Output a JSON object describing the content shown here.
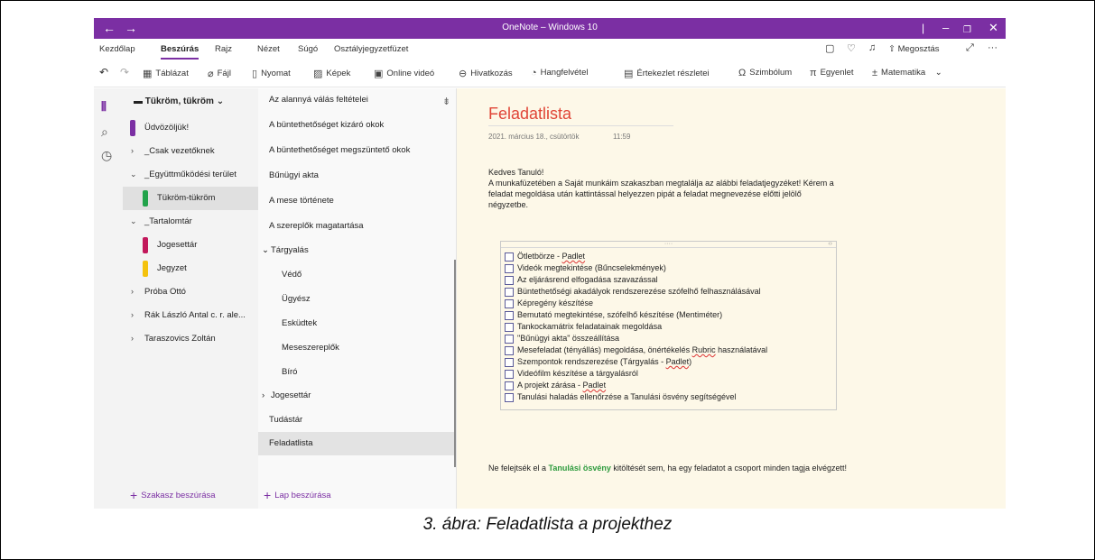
{
  "window": {
    "title": "OneNote – Windows 10",
    "back_icon": "arrow-left",
    "forward_icon": "arrow-right",
    "accent": "#7b2fa3"
  },
  "menu": {
    "items": [
      "Kezdőlap",
      "Beszúrás",
      "Rajz",
      "Nézet",
      "Súgó",
      "Osztályjegyzetfüzet"
    ],
    "active": "Beszúrás",
    "share": "Megosztás"
  },
  "toolbar": {
    "items": [
      "Táblázat",
      "Fájl",
      "Nyomat",
      "Képek",
      "Online videó",
      "Hivatkozás",
      "Hangfelvétel",
      "Értekezlet részletei",
      "Szimbólum",
      "Egyenlet",
      "Matematika"
    ]
  },
  "notebook": {
    "name": "Tükröm, tükröm"
  },
  "sections": [
    {
      "label": "Üdvözöljük!",
      "color": "#7b2fa3",
      "chevron": ""
    },
    {
      "label": "_Csak vezetőknek",
      "chevron": ">"
    },
    {
      "label": "_Együttműködési terület",
      "chevron": "v"
    },
    {
      "label": "Tükröm-tükröm",
      "color": "#22a34b",
      "chevron": ""
    },
    {
      "label": "_Tartalomtár",
      "chevron": "v"
    },
    {
      "label": "Jogesettár",
      "color": "#c2185b",
      "chevron": ""
    },
    {
      "label": "Jegyzet",
      "color": "#f4c20d",
      "chevron": ""
    },
    {
      "label": "Próba Ottó",
      "chevron": ">"
    },
    {
      "label": "Rák László Antal c. r. ale...",
      "chevron": ">"
    },
    {
      "label": "Taraszovics Zoltán",
      "chevron": ">"
    }
  ],
  "add_section": "Szakasz beszúrása",
  "pages": [
    {
      "label": "Az alannyá válás feltételei",
      "chevron": ""
    },
    {
      "label": "A büntethetőséget kizáró okok",
      "chevron": ""
    },
    {
      "label": "A büntethetőséget megszüntető okok",
      "chevron": ""
    },
    {
      "label": "Bűnügyi akta",
      "chevron": ""
    },
    {
      "label": "A mese története",
      "chevron": ""
    },
    {
      "label": "A szereplők magatartása",
      "chevron": ""
    },
    {
      "label": "Tárgyalás",
      "chevron": "v"
    },
    {
      "label": "Védő",
      "chevron": ""
    },
    {
      "label": "Ügyész",
      "chevron": ""
    },
    {
      "label": "Esküdtek",
      "chevron": ""
    },
    {
      "label": "Meseszereplők",
      "chevron": ""
    },
    {
      "label": "Bíró",
      "chevron": ""
    },
    {
      "label": "Jogesettár",
      "chevron": ">"
    },
    {
      "label": "Tudástár",
      "chevron": ""
    },
    {
      "label": "Feladatlista",
      "chevron": ""
    }
  ],
  "add_page": "Lap beszúrása",
  "note": {
    "title": "Feladatlista",
    "date": "2021. március 18., csütörtök",
    "time": "11:59",
    "greeting": "Kedves Tanuló!",
    "intro_1": "A munkafüzetében a Saját munkáim szakaszban megtalálja az alábbi feladatjegyzéket! Kérem a",
    "intro_2": "feladat megoldása után kattintással helyezzen pipát a feladat megnevezése előtti jelölő",
    "intro_3": "négyzetbe.",
    "tasks": [
      {
        "pre": "Ötletbörze - ",
        "ul": "Padlet",
        "post": ""
      },
      {
        "pre": "Videók megtekintése (Bűncselekmények)",
        "ul": "",
        "post": ""
      },
      {
        "pre": "Az eljárásrend elfogadása szavazással",
        "ul": "",
        "post": ""
      },
      {
        "pre": "Büntethetőségi akadályok rendszerezése szófelhő felhasználásával",
        "ul": "",
        "post": ""
      },
      {
        "pre": "Képregény készítése",
        "ul": "",
        "post": ""
      },
      {
        "pre": "Bemutató megtekintése, szófelhő készítése (Mentiméter)",
        "ul": "",
        "post": ""
      },
      {
        "pre": "Tankockamátrix feladatainak megoldása",
        "ul": "",
        "post": ""
      },
      {
        "pre": "\"Bűnügyi akta\" összeállítása",
        "ul": "",
        "post": ""
      },
      {
        "pre": "Mesefeladat (tényállás) megoldása, önértékelés ",
        "ul": "Rubric",
        "post": " használatával"
      },
      {
        "pre": "Szempontok rendszerezése (Tárgyalás - ",
        "ul": "Padlet",
        "post": ")"
      },
      {
        "pre": "Videófilm készítése a tárgyalásról",
        "ul": "",
        "post": ""
      },
      {
        "pre": "A projekt zárása - ",
        "ul": "Padlet",
        "post": ""
      },
      {
        "pre": "Tanulási haladás ellenőrzése a Tanulási ösvény segítségével",
        "ul": "",
        "post": ""
      }
    ],
    "footer_pre": "Ne felejtsék el a ",
    "footer_link": "Tanulási ösvény",
    "footer_post": " kitöltését sem, ha egy feladatot a csoport minden tagja elvégzett!"
  },
  "caption": "3. ábra: Feladatlista a projekthez"
}
